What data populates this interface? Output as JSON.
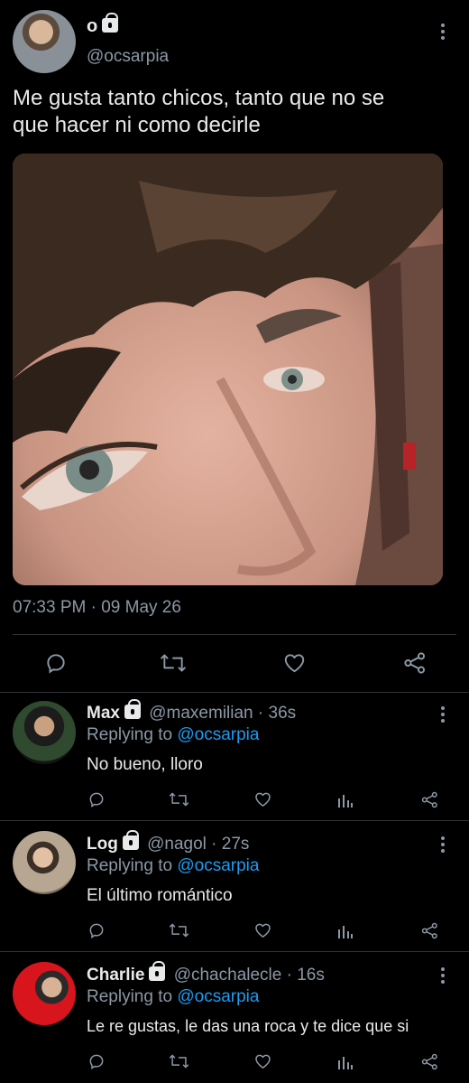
{
  "main_tweet": {
    "display_name": "o",
    "handle": "@ocsarpia",
    "text_line1": "Me gusta tanto chicos, tanto que no se",
    "text_line2": "que hacer ni como decirle",
    "timestamp": "07:33 PM · 09 May 26"
  },
  "replies": [
    {
      "display_name": "Max",
      "handle_time": "@maxemilian · 36s",
      "replying_prefix": "Replying to",
      "replying_to": "@ocsarpia",
      "text": "No bueno, lloro"
    },
    {
      "display_name": "Log",
      "handle_time": "@nagol · 27s",
      "replying_prefix": "Replying to",
      "replying_to": "@ocsarpia",
      "text": "El último romántico"
    },
    {
      "display_name": "Charlie",
      "handle_time": "@chachalecle · 16s",
      "replying_prefix": "Replying to",
      "replying_to": "@ocsarpia",
      "text": "Le re gustas, le das una roca y te dice que si"
    }
  ],
  "colors": {
    "background": "#000000",
    "text": "#e7e9ea",
    "secondary": "#8b98a5",
    "link": "#1d9bf0",
    "divider": "#2f3336"
  },
  "icons": [
    "lock-icon",
    "more-icon",
    "reply-icon",
    "retweet-icon",
    "like-icon",
    "share-icon",
    "stats-icon"
  ]
}
